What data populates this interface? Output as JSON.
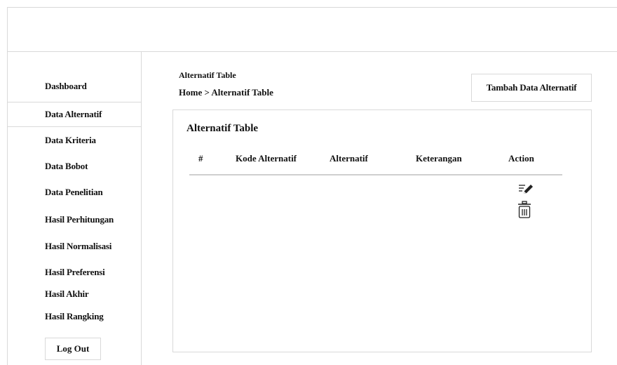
{
  "sidebar": {
    "items": [
      {
        "label": "Dashboard"
      },
      {
        "label": "Data Alternatif"
      },
      {
        "label": "Data Kriteria"
      },
      {
        "label": "Data Bobot"
      },
      {
        "label": "Data Penelitian"
      },
      {
        "label": "Hasil Perhitungan"
      },
      {
        "label": "Hasil Normalisasi"
      },
      {
        "label": "Hasil Preferensi"
      },
      {
        "label": "Hasil Akhir"
      },
      {
        "label": "Hasil Rangking"
      }
    ],
    "logout_label": "Log Out"
  },
  "header": {
    "title": "Alternatif Table",
    "breadcrumb": "Home > Alternatif Table",
    "add_button_label": "Tambah Data Alternatif"
  },
  "table": {
    "title": "Alternatif Table",
    "columns": [
      "#",
      "Kode Alternatif",
      "Alternatif",
      "Keterangan",
      "Action"
    ],
    "row_actions": [
      {
        "icon": "edit-icon"
      },
      {
        "icon": "trash-icon"
      }
    ]
  }
}
